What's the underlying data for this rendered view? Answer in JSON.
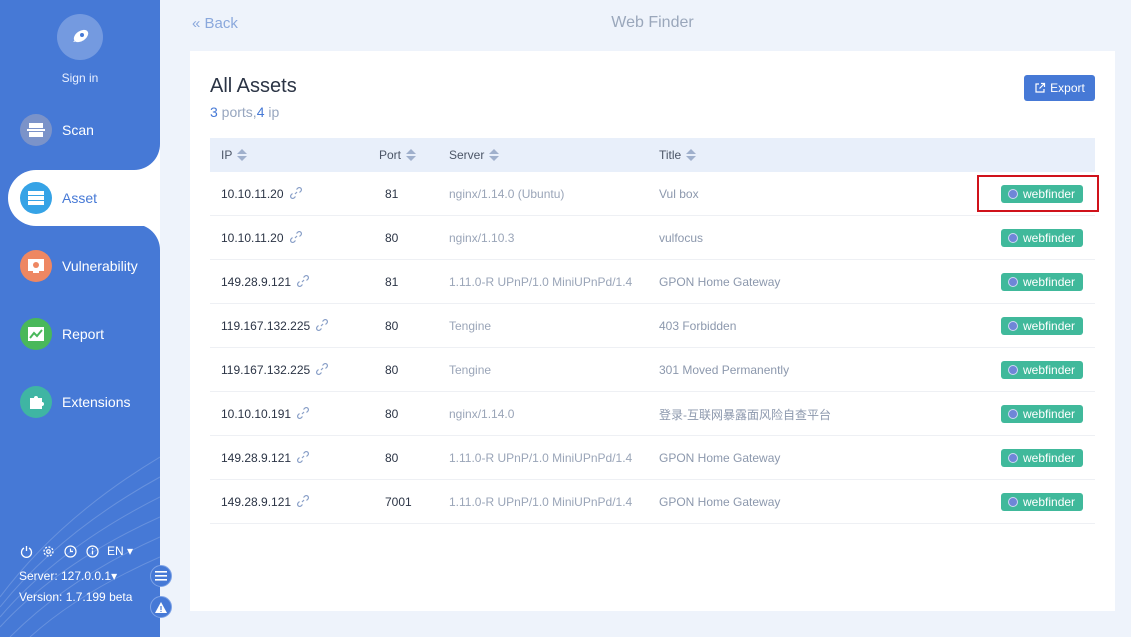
{
  "sidebar": {
    "signin_label": "Sign in",
    "items": [
      {
        "label": "Scan",
        "icon": "scan-icon",
        "color": "#7b93c9"
      },
      {
        "label": "Asset",
        "icon": "asset-icon",
        "color": "#36a3e6"
      },
      {
        "label": "Vulnerability",
        "icon": "bug-icon",
        "color": "#ee8762"
      },
      {
        "label": "Report",
        "icon": "chart-icon",
        "color": "#49b85a"
      },
      {
        "label": "Extensions",
        "icon": "puzzle-icon",
        "color": "#3fb5a3"
      }
    ],
    "language": "EN",
    "server": "Server: 127.0.0.1",
    "version": "Version: 1.7.199 beta"
  },
  "header": {
    "back_label": "Back",
    "title": "Web Finder"
  },
  "card": {
    "title": "All Assets",
    "ports_count": "3",
    "ports_text": " ports,",
    "ip_count": "4",
    "ip_text": " ip",
    "export_label": "Export"
  },
  "table": {
    "columns": [
      "IP",
      "Port",
      "Server",
      "Title"
    ],
    "rows": [
      {
        "ip": "10.10.11.20",
        "port": "81",
        "server": "nginx/1.14.0 (Ubuntu)",
        "title": "Vul box",
        "tag": "webfinder"
      },
      {
        "ip": "10.10.11.20",
        "port": "80",
        "server": "nginx/1.10.3",
        "title": "vulfocus",
        "tag": "webfinder"
      },
      {
        "ip": "149.28.9.121",
        "port": "81",
        "server": "1.11.0-R UPnP/1.0 MiniUPnPd/1.4",
        "title": "GPON Home Gateway",
        "tag": "webfinder"
      },
      {
        "ip": "119.167.132.225",
        "port": "80",
        "server": "Tengine",
        "title": "403 Forbidden",
        "tag": "webfinder"
      },
      {
        "ip": "119.167.132.225",
        "port": "80",
        "server": "Tengine",
        "title": "301 Moved Permanently",
        "tag": "webfinder"
      },
      {
        "ip": "10.10.10.191",
        "port": "80",
        "server": "nginx/1.14.0",
        "title": "登录-互联网暴露面风险自查平台",
        "tag": "webfinder"
      },
      {
        "ip": "149.28.9.121",
        "port": "80",
        "server": "1.11.0-R UPnP/1.0 MiniUPnPd/1.4",
        "title": "GPON Home Gateway",
        "tag": "webfinder"
      },
      {
        "ip": "149.28.9.121",
        "port": "7001",
        "server": "1.11.0-R UPnP/1.0 MiniUPnPd/1.4",
        "title": "GPON Home Gateway",
        "tag": "webfinder"
      }
    ]
  },
  "colors": {
    "sidebar": "#4679d6",
    "tag": "#40b99b",
    "highlight": "#d0121b"
  }
}
